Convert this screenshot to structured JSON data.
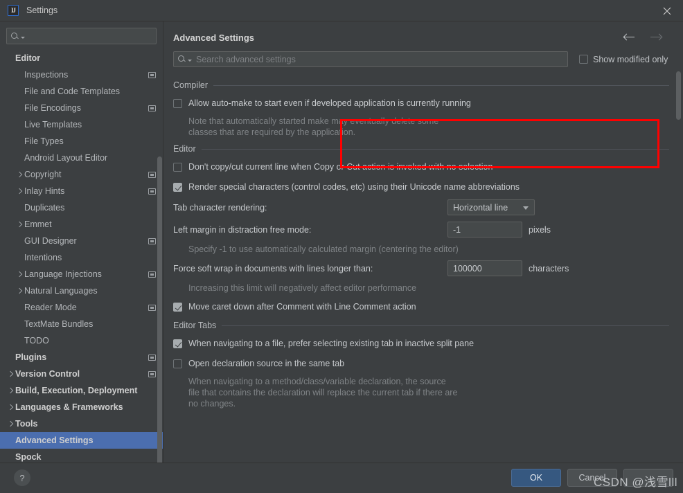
{
  "window": {
    "title": "Settings",
    "app_icon": "intellij-idea-logo",
    "logo_text": "IJ",
    "close_icon": "close-icon"
  },
  "sidebar": {
    "search": {
      "placeholder": "",
      "value": "",
      "icon": "search-icon"
    },
    "items": [
      {
        "label": "Editor",
        "type": "group",
        "indent": 0,
        "chevron": "none",
        "badge": false
      },
      {
        "label": "Inspections",
        "type": "leaf",
        "indent": 1,
        "chevron": "none",
        "badge": true
      },
      {
        "label": "File and Code Templates",
        "type": "leaf",
        "indent": 1,
        "chevron": "none",
        "badge": false
      },
      {
        "label": "File Encodings",
        "type": "leaf",
        "indent": 1,
        "chevron": "none",
        "badge": true
      },
      {
        "label": "Live Templates",
        "type": "leaf",
        "indent": 1,
        "chevron": "none",
        "badge": false
      },
      {
        "label": "File Types",
        "type": "leaf",
        "indent": 1,
        "chevron": "none",
        "badge": false
      },
      {
        "label": "Android Layout Editor",
        "type": "leaf",
        "indent": 1,
        "chevron": "none",
        "badge": false
      },
      {
        "label": "Copyright",
        "type": "leaf",
        "indent": 1,
        "chevron": "closed",
        "badge": true
      },
      {
        "label": "Inlay Hints",
        "type": "leaf",
        "indent": 1,
        "chevron": "closed",
        "badge": true
      },
      {
        "label": "Duplicates",
        "type": "leaf",
        "indent": 1,
        "chevron": "none",
        "badge": false
      },
      {
        "label": "Emmet",
        "type": "leaf",
        "indent": 1,
        "chevron": "closed",
        "badge": false
      },
      {
        "label": "GUI Designer",
        "type": "leaf",
        "indent": 1,
        "chevron": "none",
        "badge": true
      },
      {
        "label": "Intentions",
        "type": "leaf",
        "indent": 1,
        "chevron": "none",
        "badge": false
      },
      {
        "label": "Language Injections",
        "type": "leaf",
        "indent": 1,
        "chevron": "closed",
        "badge": true
      },
      {
        "label": "Natural Languages",
        "type": "leaf",
        "indent": 1,
        "chevron": "closed",
        "badge": false
      },
      {
        "label": "Reader Mode",
        "type": "leaf",
        "indent": 1,
        "chevron": "none",
        "badge": true
      },
      {
        "label": "TextMate Bundles",
        "type": "leaf",
        "indent": 1,
        "chevron": "none",
        "badge": false
      },
      {
        "label": "TODO",
        "type": "leaf",
        "indent": 1,
        "chevron": "none",
        "badge": false
      },
      {
        "label": "Plugins",
        "type": "group",
        "indent": 0,
        "chevron": "none",
        "badge": true
      },
      {
        "label": "Version Control",
        "type": "group",
        "indent": 0,
        "chevron": "closed",
        "badge": true
      },
      {
        "label": "Build, Execution, Deployment",
        "type": "group",
        "indent": 0,
        "chevron": "closed",
        "badge": false
      },
      {
        "label": "Languages & Frameworks",
        "type": "group",
        "indent": 0,
        "chevron": "closed",
        "badge": false
      },
      {
        "label": "Tools",
        "type": "group",
        "indent": 0,
        "chevron": "closed",
        "badge": false
      },
      {
        "label": "Advanced Settings",
        "type": "group",
        "indent": 0,
        "chevron": "none",
        "badge": false,
        "selected": true
      },
      {
        "label": "Spock",
        "type": "group",
        "indent": 0,
        "chevron": "none",
        "badge": false
      }
    ]
  },
  "main": {
    "title": "Advanced Settings",
    "nav": {
      "back_icon": "arrow-left-icon",
      "forward_icon": "arrow-right-icon"
    },
    "search": {
      "placeholder": "Search advanced settings",
      "value": "",
      "icon": "search-icon"
    },
    "show_modified_only": {
      "label": "Show modified only",
      "checked": false
    },
    "sections": [
      {
        "title": "Compiler",
        "highlighted": true,
        "rows": [
          {
            "kind": "checkbox",
            "label": "Allow auto-make to start even if developed application is currently running",
            "checked": false,
            "hint": "Note that automatically started make may eventually delete some classes that are required by the application."
          }
        ]
      },
      {
        "title": "Editor",
        "highlighted": false,
        "rows": [
          {
            "kind": "checkbox",
            "label": "Don't copy/cut current line when Copy or Cut action is invoked with no selection",
            "checked": false,
            "hint": ""
          },
          {
            "kind": "checkbox",
            "label": "Render special characters (control codes, etc) using their Unicode name abbreviations",
            "checked": true,
            "hint": ""
          },
          {
            "kind": "combo",
            "label": "Tab character rendering:",
            "value": "Horizontal line",
            "unit": "",
            "hint": ""
          },
          {
            "kind": "text",
            "label": "Left margin in distraction free mode:",
            "value": "-1",
            "unit": "pixels",
            "hint": "Specify -1 to use automatically calculated margin (centering the editor)"
          },
          {
            "kind": "text",
            "label": "Force soft wrap in documents with lines longer than:",
            "value": "100000",
            "unit": "characters",
            "hint": "Increasing this limit will negatively affect editor performance"
          },
          {
            "kind": "checkbox",
            "label": "Move caret down after Comment with Line Comment action",
            "checked": true,
            "hint": ""
          }
        ]
      },
      {
        "title": "Editor Tabs",
        "highlighted": false,
        "rows": [
          {
            "kind": "checkbox",
            "label": "When navigating to a file, prefer selecting existing tab in inactive split pane",
            "checked": true,
            "hint": ""
          },
          {
            "kind": "checkbox",
            "label": "Open declaration source in the same tab",
            "checked": false,
            "hint": "When navigating to a method/class/variable declaration, the source file that contains the declaration will replace the current tab if there are no changes."
          }
        ]
      }
    ]
  },
  "footer": {
    "help_label": "?",
    "ok_label": "OK",
    "cancel_label": "Cancel",
    "apply_label": ""
  },
  "watermark": {
    "text": "CSDN @浅雪lll"
  },
  "colors": {
    "background": "#3c3f41",
    "selection": "#4b6eaf",
    "primary_button": "#365880",
    "highlight_box": "#ff0000",
    "field_background": "#45494a"
  }
}
